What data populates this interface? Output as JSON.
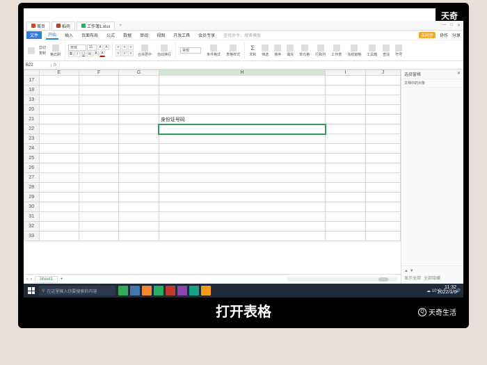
{
  "watermark_top": "天奇",
  "caption": "打开表格",
  "watermark_bottom": "天奇生活",
  "timestamp": {
    "time": "11:32",
    "date": "2022/1/6"
  },
  "tabs": [
    {
      "label": "首页",
      "icon": "wps"
    },
    {
      "label": "稻壳",
      "icon": "pdf"
    },
    {
      "label": "工作簿1.xlsx",
      "icon": "xls"
    }
  ],
  "menu": {
    "file": "文件",
    "items": [
      "开始",
      "插入",
      "页面布局",
      "公式",
      "数据",
      "审阅",
      "视图",
      "开发工具",
      "会员专享"
    ],
    "active": "开始",
    "search_placeholder": "查找命令、搜索模板",
    "sync": "未同步",
    "coop": "协作",
    "share": "分享"
  },
  "ribbon": {
    "clipboard": "剪切",
    "copy": "复制",
    "format_painter": "格式刷",
    "font": "宋体",
    "font_size": "11",
    "merge": "合并居中",
    "wrap": "自动换行",
    "general": "常规",
    "cond_format": "条件格式",
    "cell_style": "表格样式",
    "sum": "求和",
    "filter": "筛选",
    "sort": "排序",
    "fill": "填充",
    "cell": "单元格",
    "row_col": "行和列",
    "worksheet": "工作表",
    "freeze": "冻结窗格",
    "tools": "工具箱",
    "find": "查找",
    "symbol": "符号"
  },
  "name_box": "B22",
  "fx": "fx",
  "columns": [
    "E",
    "F",
    "G",
    "H",
    "I",
    "J"
  ],
  "selected_col": "H",
  "rows": [
    17,
    18,
    19,
    20,
    21,
    22,
    23,
    24,
    25,
    26,
    27,
    28,
    29,
    30,
    31,
    32,
    33
  ],
  "selected_row": 22,
  "cells": {
    "H21": "身份证号码"
  },
  "panel": {
    "title": "选择窗格",
    "subtitle": "文档中的对象",
    "show_all": "显示全部",
    "hide_all": "全部隐藏"
  },
  "sheet_name": "Sheet1",
  "taskbar": {
    "search_placeholder": "在这里输入你要搜索的内容",
    "weather": "10°C"
  }
}
